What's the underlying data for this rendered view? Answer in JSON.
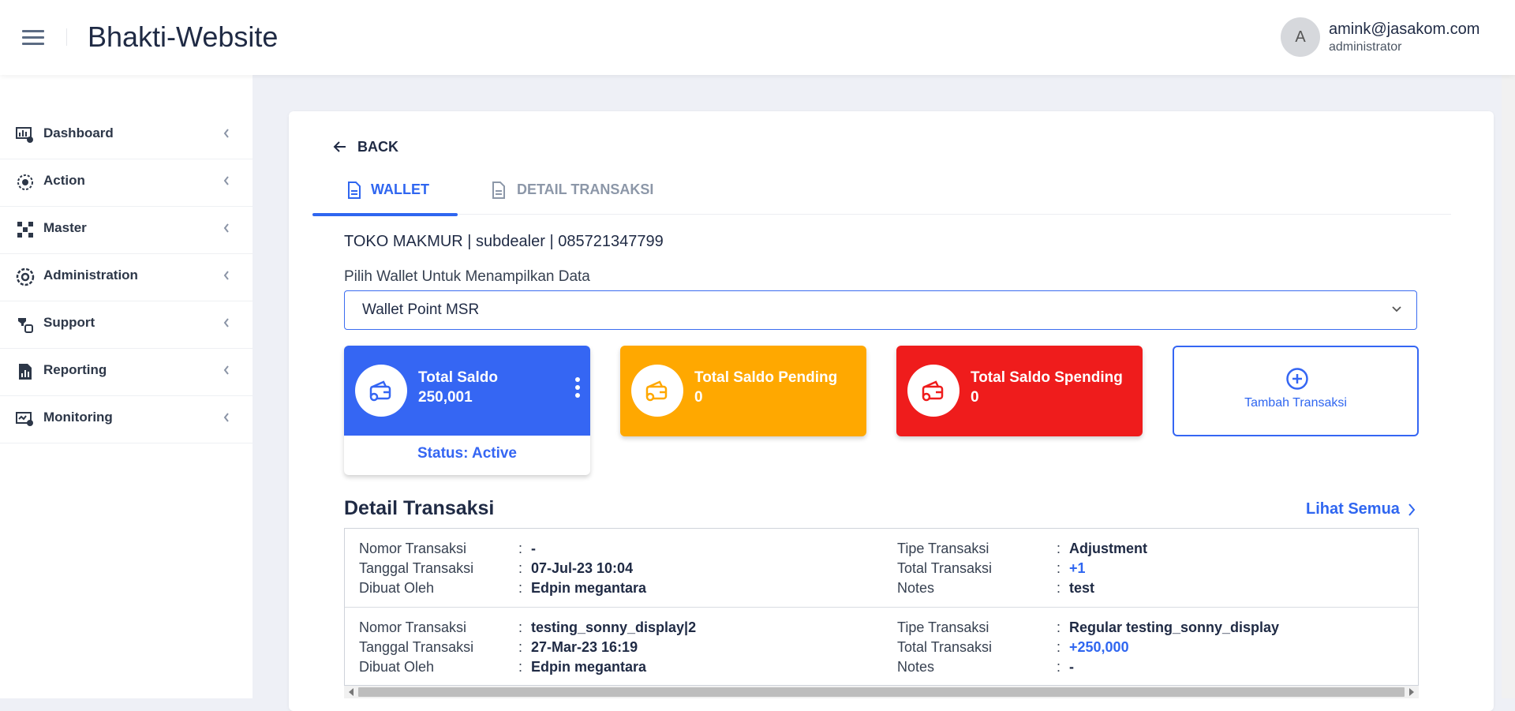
{
  "header": {
    "app_title": "Bhakti-Website",
    "user": {
      "avatar_initial": "A",
      "email": "amink@jasakom.com",
      "role": "administrator"
    }
  },
  "sidebar": {
    "items": [
      {
        "label": "Dashboard",
        "icon": "dashboard-icon"
      },
      {
        "label": "Action",
        "icon": "action-icon"
      },
      {
        "label": "Master",
        "icon": "master-icon"
      },
      {
        "label": "Administration",
        "icon": "administration-icon"
      },
      {
        "label": "Support",
        "icon": "support-icon"
      },
      {
        "label": "Reporting",
        "icon": "reporting-icon"
      },
      {
        "label": "Monitoring",
        "icon": "monitoring-icon"
      }
    ]
  },
  "main": {
    "back_label": "BACK",
    "tabs": [
      {
        "label": "WALLET",
        "active": true
      },
      {
        "label": "DETAIL TRANSAKSI",
        "active": false
      }
    ],
    "store_info": "TOKO MAKMUR | subdealer | 085721347799",
    "wallet_select": {
      "label": "Pilih Wallet Untuk Menampilkan Data",
      "value": "Wallet Point MSR"
    },
    "tiles": {
      "total_saldo": {
        "title": "Total Saldo",
        "value": "250,001",
        "status": "Status: Active"
      },
      "saldo_pending": {
        "title": "Total Saldo Pending",
        "value": "0"
      },
      "saldo_spending": {
        "title": "Total Saldo Spending",
        "value": "0"
      },
      "add": {
        "label": "Tambah Transaksi"
      }
    },
    "detail": {
      "heading": "Detail Transaksi",
      "see_all": "Lihat Semua",
      "labels": {
        "nomor": "Nomor Transaksi",
        "tanggal": "Tanggal Transaksi",
        "dibuat": "Dibuat Oleh",
        "tipe": "Tipe Transaksi",
        "total": "Total Transaksi",
        "notes": "Notes"
      },
      "transactions": [
        {
          "nomor": "-",
          "tanggal": "07-Jul-23 10:04",
          "dibuat": "Edpin megantara",
          "tipe": "Adjustment",
          "total": "+1",
          "notes": "test"
        },
        {
          "nomor": "testing_sonny_display|2",
          "tanggal": "27-Mar-23 16:19",
          "dibuat": "Edpin megantara",
          "tipe": "Regular testing_sonny_display",
          "total": "+250,000",
          "notes": "-"
        }
      ]
    }
  },
  "colors": {
    "primary": "#3566f3",
    "pending": "#ffa800",
    "spending": "#ef1c1c",
    "background": "#eef0f6"
  }
}
